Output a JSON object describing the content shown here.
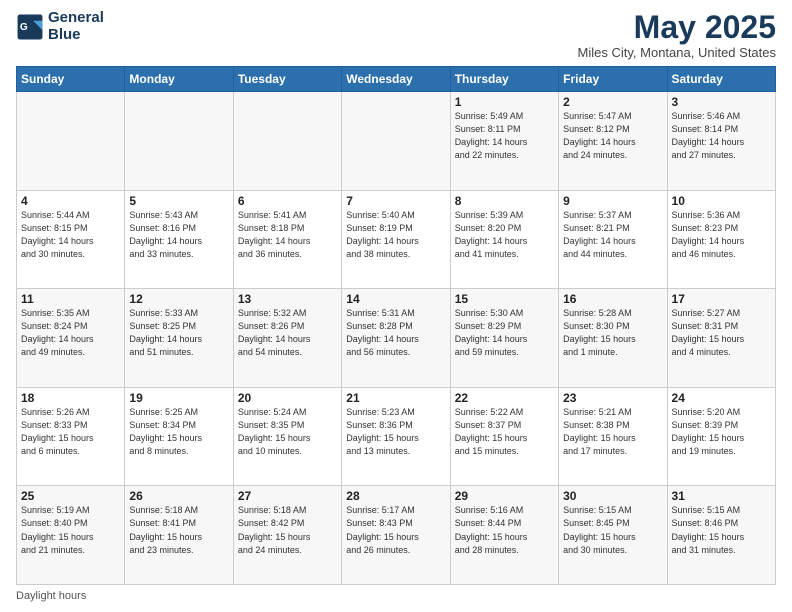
{
  "header": {
    "logo_line1": "General",
    "logo_line2": "Blue",
    "main_title": "May 2025",
    "subtitle": "Miles City, Montana, United States"
  },
  "days_of_week": [
    "Sunday",
    "Monday",
    "Tuesday",
    "Wednesday",
    "Thursday",
    "Friday",
    "Saturday"
  ],
  "weeks": [
    [
      {
        "day": "",
        "info": ""
      },
      {
        "day": "",
        "info": ""
      },
      {
        "day": "",
        "info": ""
      },
      {
        "day": "",
        "info": ""
      },
      {
        "day": "1",
        "info": "Sunrise: 5:49 AM\nSunset: 8:11 PM\nDaylight: 14 hours\nand 22 minutes."
      },
      {
        "day": "2",
        "info": "Sunrise: 5:47 AM\nSunset: 8:12 PM\nDaylight: 14 hours\nand 24 minutes."
      },
      {
        "day": "3",
        "info": "Sunrise: 5:46 AM\nSunset: 8:14 PM\nDaylight: 14 hours\nand 27 minutes."
      }
    ],
    [
      {
        "day": "4",
        "info": "Sunrise: 5:44 AM\nSunset: 8:15 PM\nDaylight: 14 hours\nand 30 minutes."
      },
      {
        "day": "5",
        "info": "Sunrise: 5:43 AM\nSunset: 8:16 PM\nDaylight: 14 hours\nand 33 minutes."
      },
      {
        "day": "6",
        "info": "Sunrise: 5:41 AM\nSunset: 8:18 PM\nDaylight: 14 hours\nand 36 minutes."
      },
      {
        "day": "7",
        "info": "Sunrise: 5:40 AM\nSunset: 8:19 PM\nDaylight: 14 hours\nand 38 minutes."
      },
      {
        "day": "8",
        "info": "Sunrise: 5:39 AM\nSunset: 8:20 PM\nDaylight: 14 hours\nand 41 minutes."
      },
      {
        "day": "9",
        "info": "Sunrise: 5:37 AM\nSunset: 8:21 PM\nDaylight: 14 hours\nand 44 minutes."
      },
      {
        "day": "10",
        "info": "Sunrise: 5:36 AM\nSunset: 8:23 PM\nDaylight: 14 hours\nand 46 minutes."
      }
    ],
    [
      {
        "day": "11",
        "info": "Sunrise: 5:35 AM\nSunset: 8:24 PM\nDaylight: 14 hours\nand 49 minutes."
      },
      {
        "day": "12",
        "info": "Sunrise: 5:33 AM\nSunset: 8:25 PM\nDaylight: 14 hours\nand 51 minutes."
      },
      {
        "day": "13",
        "info": "Sunrise: 5:32 AM\nSunset: 8:26 PM\nDaylight: 14 hours\nand 54 minutes."
      },
      {
        "day": "14",
        "info": "Sunrise: 5:31 AM\nSunset: 8:28 PM\nDaylight: 14 hours\nand 56 minutes."
      },
      {
        "day": "15",
        "info": "Sunrise: 5:30 AM\nSunset: 8:29 PM\nDaylight: 14 hours\nand 59 minutes."
      },
      {
        "day": "16",
        "info": "Sunrise: 5:28 AM\nSunset: 8:30 PM\nDaylight: 15 hours\nand 1 minute."
      },
      {
        "day": "17",
        "info": "Sunrise: 5:27 AM\nSunset: 8:31 PM\nDaylight: 15 hours\nand 4 minutes."
      }
    ],
    [
      {
        "day": "18",
        "info": "Sunrise: 5:26 AM\nSunset: 8:33 PM\nDaylight: 15 hours\nand 6 minutes."
      },
      {
        "day": "19",
        "info": "Sunrise: 5:25 AM\nSunset: 8:34 PM\nDaylight: 15 hours\nand 8 minutes."
      },
      {
        "day": "20",
        "info": "Sunrise: 5:24 AM\nSunset: 8:35 PM\nDaylight: 15 hours\nand 10 minutes."
      },
      {
        "day": "21",
        "info": "Sunrise: 5:23 AM\nSunset: 8:36 PM\nDaylight: 15 hours\nand 13 minutes."
      },
      {
        "day": "22",
        "info": "Sunrise: 5:22 AM\nSunset: 8:37 PM\nDaylight: 15 hours\nand 15 minutes."
      },
      {
        "day": "23",
        "info": "Sunrise: 5:21 AM\nSunset: 8:38 PM\nDaylight: 15 hours\nand 17 minutes."
      },
      {
        "day": "24",
        "info": "Sunrise: 5:20 AM\nSunset: 8:39 PM\nDaylight: 15 hours\nand 19 minutes."
      }
    ],
    [
      {
        "day": "25",
        "info": "Sunrise: 5:19 AM\nSunset: 8:40 PM\nDaylight: 15 hours\nand 21 minutes."
      },
      {
        "day": "26",
        "info": "Sunrise: 5:18 AM\nSunset: 8:41 PM\nDaylight: 15 hours\nand 23 minutes."
      },
      {
        "day": "27",
        "info": "Sunrise: 5:18 AM\nSunset: 8:42 PM\nDaylight: 15 hours\nand 24 minutes."
      },
      {
        "day": "28",
        "info": "Sunrise: 5:17 AM\nSunset: 8:43 PM\nDaylight: 15 hours\nand 26 minutes."
      },
      {
        "day": "29",
        "info": "Sunrise: 5:16 AM\nSunset: 8:44 PM\nDaylight: 15 hours\nand 28 minutes."
      },
      {
        "day": "30",
        "info": "Sunrise: 5:15 AM\nSunset: 8:45 PM\nDaylight: 15 hours\nand 30 minutes."
      },
      {
        "day": "31",
        "info": "Sunrise: 5:15 AM\nSunset: 8:46 PM\nDaylight: 15 hours\nand 31 minutes."
      }
    ]
  ],
  "footer": {
    "label": "Daylight hours"
  }
}
